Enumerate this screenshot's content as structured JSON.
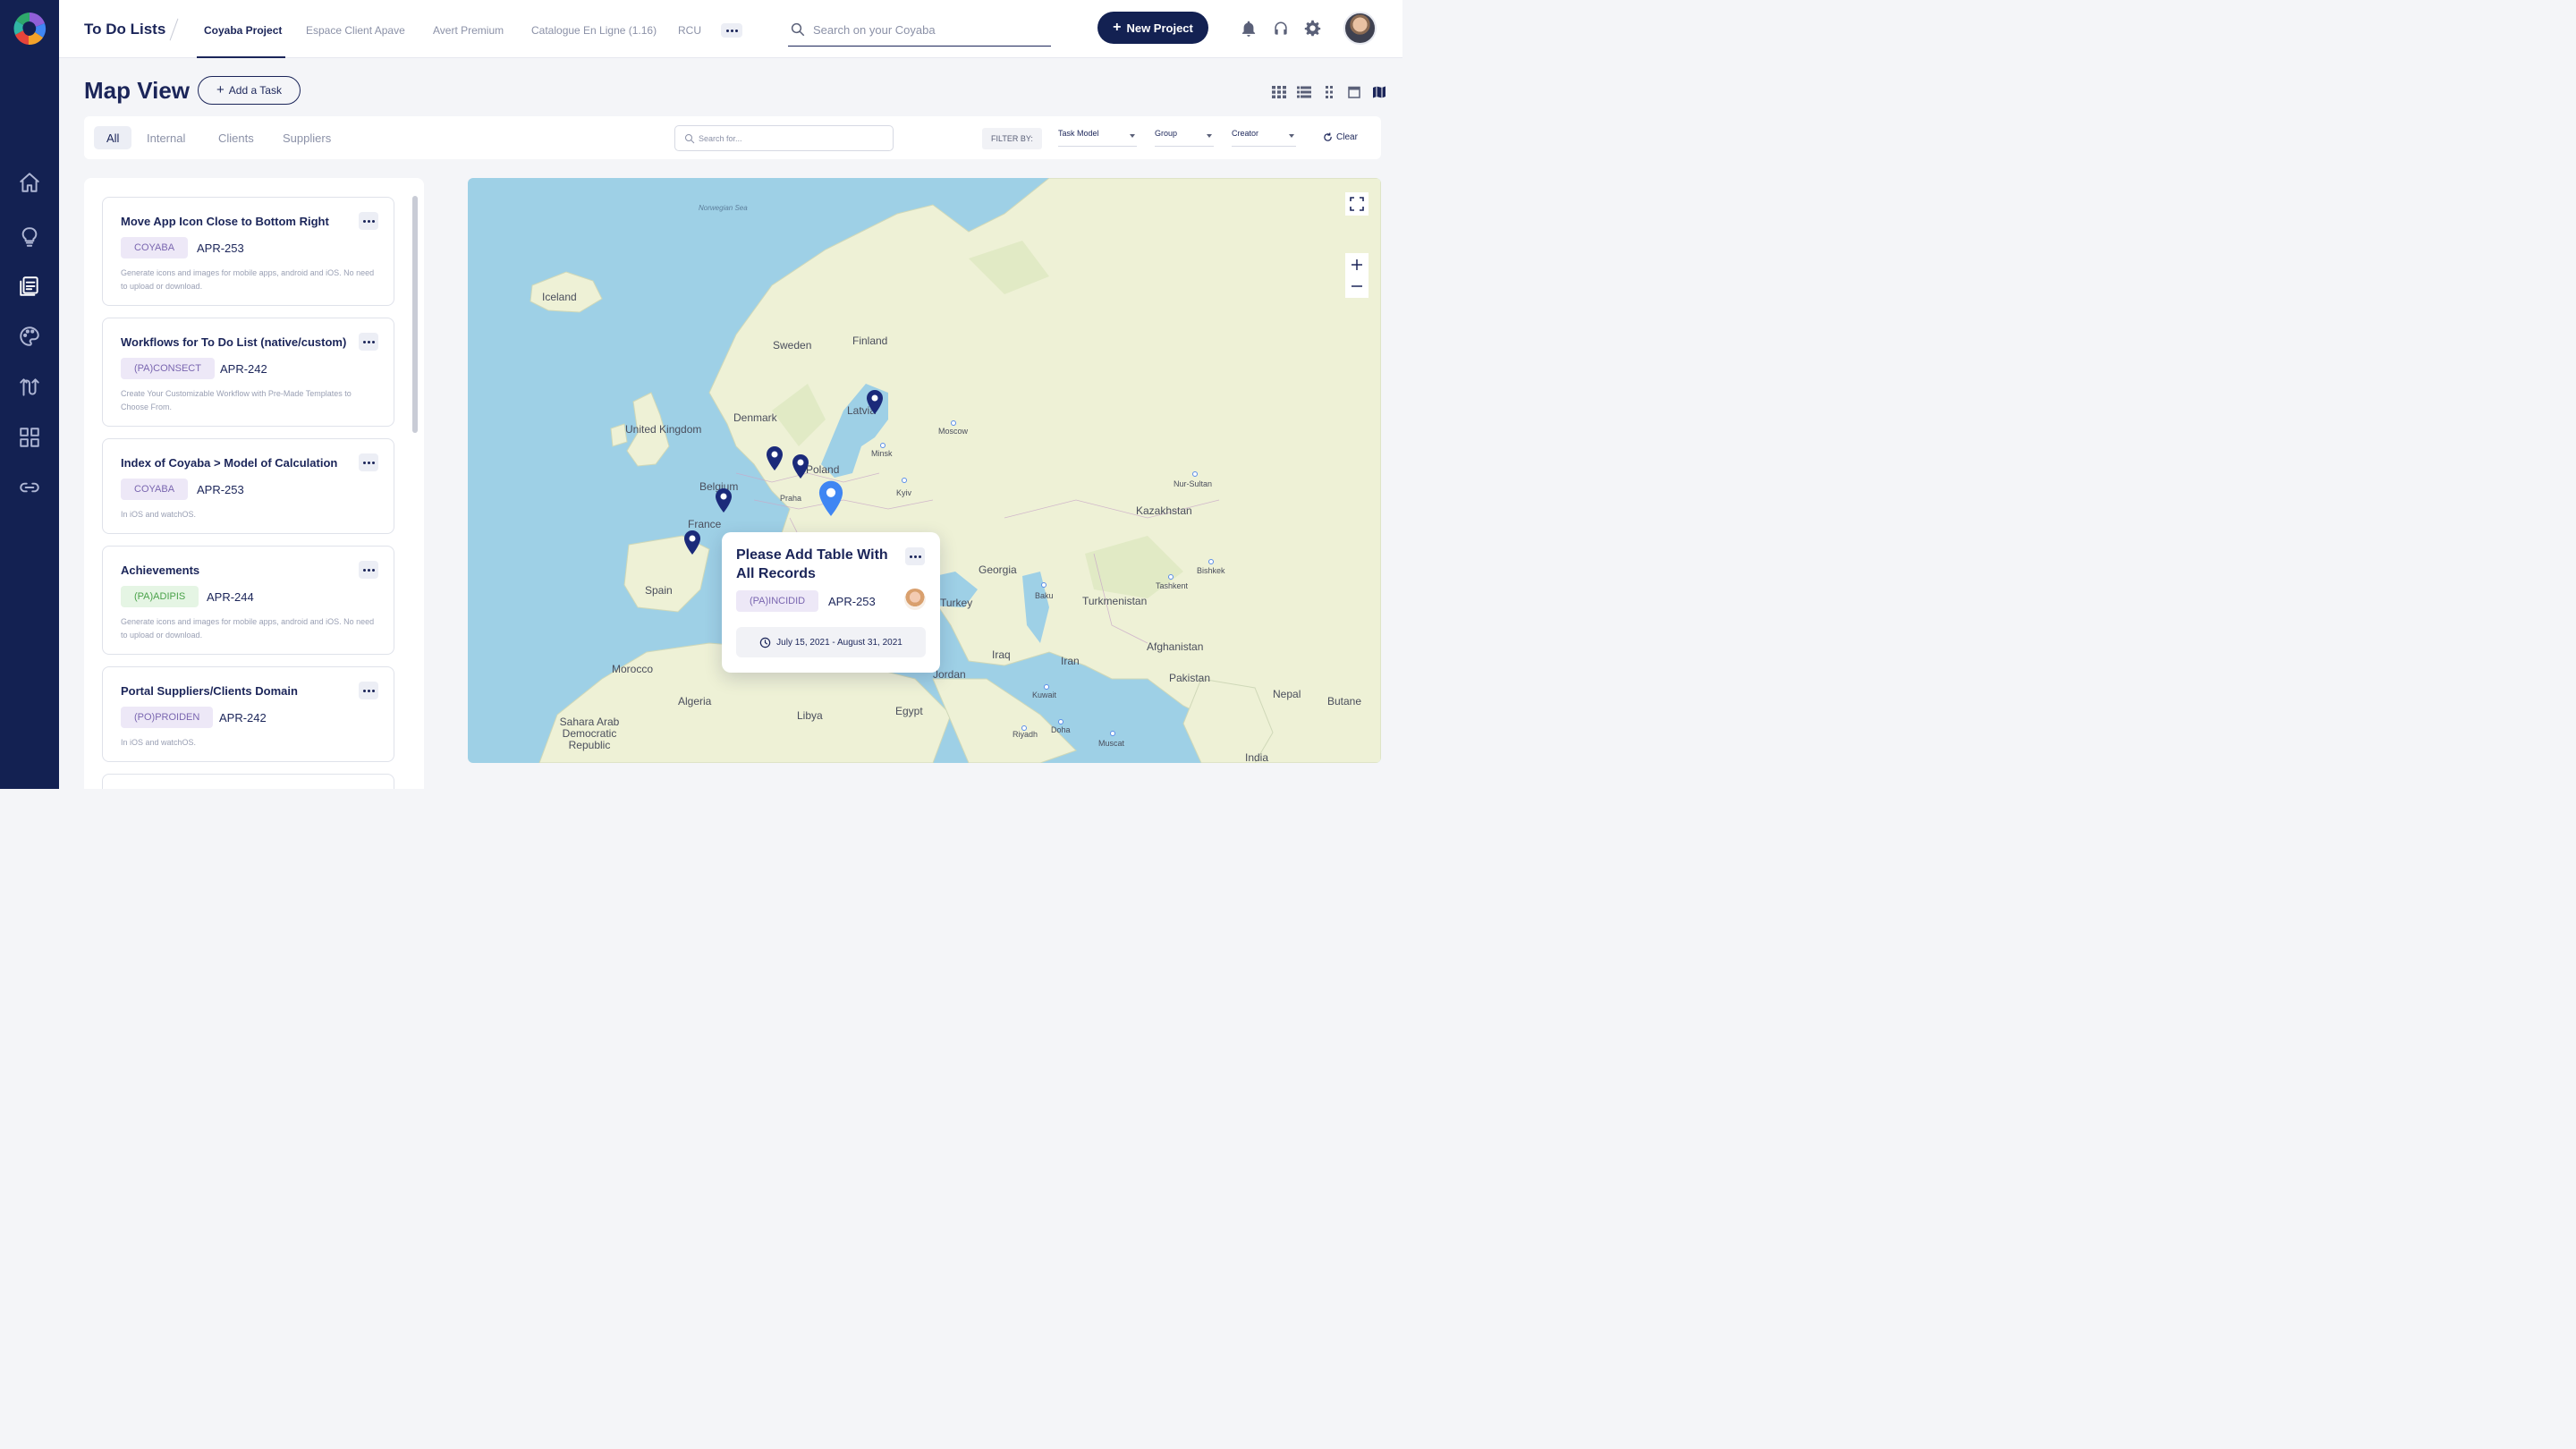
{
  "header": {
    "app_title": "To Do Lists",
    "tabs": [
      {
        "label": "Coyaba Project",
        "active": true
      },
      {
        "label": "Espace Client Apave",
        "active": false
      },
      {
        "label": "Avert Premium",
        "active": false
      },
      {
        "label": "Catalogue En Ligne (1.16)",
        "active": false
      },
      {
        "label": "RCU",
        "active": false
      }
    ],
    "search_placeholder": "Search on your Coyaba",
    "new_project_label": "New Project",
    "icons": [
      "bell-icon",
      "headset-icon",
      "gear-icon"
    ]
  },
  "sidebar": {
    "items": [
      "home-icon",
      "lightbulb-icon",
      "list-icon",
      "palette-icon",
      "route-icon",
      "grid-icon",
      "link-icon"
    ],
    "active": "list-icon"
  },
  "page": {
    "title": "Map View",
    "add_task_label": "Add a Task",
    "view_modes": [
      "grid-view-icon",
      "list-view-icon",
      "kanban-view-icon",
      "calendar-view-icon",
      "map-view-icon"
    ]
  },
  "filters": {
    "chips": [
      {
        "label": "All",
        "active": true
      },
      {
        "label": "Internal",
        "active": false
      },
      {
        "label": "Clients",
        "active": false
      },
      {
        "label": "Suppliers",
        "active": false
      }
    ],
    "search_placeholder": "Search for...",
    "filter_by_label": "FILTER BY:",
    "dropdowns": [
      "Task Model",
      "Group",
      "Creator"
    ],
    "clear_label": "Clear"
  },
  "tasks": [
    {
      "title": "Move App Icon Close to Bottom Right",
      "tag": "COYABA",
      "tag_color": "purple",
      "code": "APR-253",
      "desc": "Generate icons and images for mobile apps, android and iOS. No need to upload or download."
    },
    {
      "title": "Workflows for To Do List (native/custom)",
      "tag": "(PA)CONSECT",
      "tag_color": "purple",
      "code": "APR-242",
      "desc": "Create Your Customizable Workflow with Pre-Made Templates to Choose From."
    },
    {
      "title": "Index of Coyaba > Model of Calculation",
      "tag": "COYABA",
      "tag_color": "purple",
      "code": "APR-253",
      "desc": "In iOS and watchOS."
    },
    {
      "title": "Achievements",
      "tag": "(PA)ADIPIS",
      "tag_color": "green",
      "code": "APR-244",
      "desc": "Generate icons and images for mobile apps, android and iOS. No need to upload or download."
    },
    {
      "title": "Portal Suppliers/Clients Domain",
      "tag": "(PO)PROIDEN",
      "tag_color": "purple",
      "code": "APR-242",
      "desc": "In iOS and watchOS."
    }
  ],
  "map": {
    "labels": {
      "sea": "Norwegian Sea",
      "countries": [
        "Iceland",
        "Sweden",
        "Finland",
        "Latvia",
        "Denmark",
        "United Kingdom",
        "Poland",
        "Belgium",
        "France",
        "Spain",
        "Georgia",
        "Kazakhstan",
        "Turkmenistan",
        "Afghanistan",
        "Iraq",
        "Iran",
        "Pakistan",
        "Nepal",
        "Butane",
        "Morocco",
        "Algeria",
        "Libya",
        "Egypt",
        "Jordan",
        "Sahara Arab Democratic Republic",
        "India",
        "Turkey"
      ],
      "cities": [
        "Moscow",
        "Minsk",
        "Praha",
        "Kyiv",
        "Nur-Sultan",
        "Bishkek",
        "Tashkent",
        "Baku",
        "Kuwait",
        "Riyadh",
        "Doha",
        "Muscat"
      ]
    },
    "controls": [
      "fullscreen-icon",
      "zoom-in-icon",
      "zoom-out-icon"
    ],
    "popup": {
      "title": "Please Add Table With All Records",
      "tag": "(PA)INCIDID",
      "code": "APR-253",
      "date_range": "July 15, 2021 - August 31, 2021"
    }
  },
  "colors": {
    "navy": "#132152",
    "map_water": "#9ed0e6",
    "map_land": "#eef1d6",
    "pin": "#1b2a7a",
    "pin_selected": "#3f86f3"
  }
}
